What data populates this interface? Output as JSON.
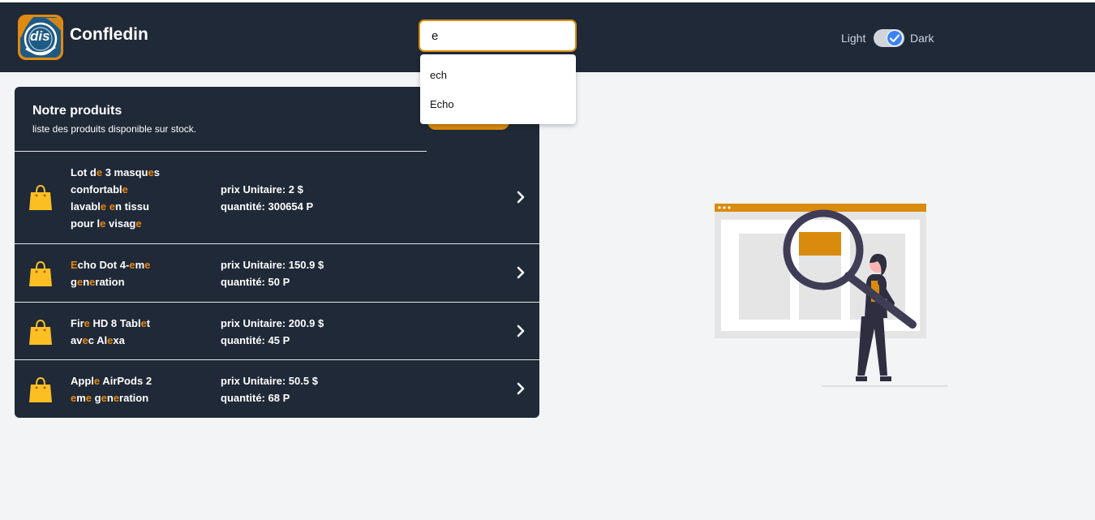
{
  "header": {
    "brand": "Confledin",
    "logo_text": "dis",
    "search_value": "e",
    "suggestions": [
      "ech",
      "Echo"
    ],
    "theme": {
      "light_label": "Light",
      "dark_label": "Dark",
      "dark_mode": true
    }
  },
  "panel": {
    "title": "Notre produits",
    "subtitle": "liste des produits disponible sur stock.",
    "products": [
      {
        "name_lines": [
          "Lot de 3 masques",
          "confortable",
          "lavable en tissu",
          "pour le visage"
        ],
        "price": "prix Unitaire: 2 $",
        "quantity": "quantité: 300654 P"
      },
      {
        "name_lines": [
          "Echo Dot 4-eme",
          "generation"
        ],
        "price": "prix Unitaire: 150.9 $",
        "quantity": "quantité: 50 P"
      },
      {
        "name_lines": [
          "Fire HD 8 Tablet",
          "avec Alexa"
        ],
        "price": "prix Unitaire: 200.9 $",
        "quantity": "quantité: 45 P"
      },
      {
        "name_lines": [
          "Apple AirPods 2",
          "eme generation"
        ],
        "price": "prix Unitaire: 50.5 $",
        "quantity": "quantité: 68 P"
      }
    ]
  },
  "colors": {
    "accent": "#d98b0e",
    "highlight": "#e8860f",
    "dark": "#1f2937",
    "background": "#f3f4f6",
    "toggle_on": "#3b82f6"
  },
  "icons": {
    "product": "shopping-bag-icon",
    "open": "chevron-right-icon",
    "toggle": "check-icon"
  }
}
